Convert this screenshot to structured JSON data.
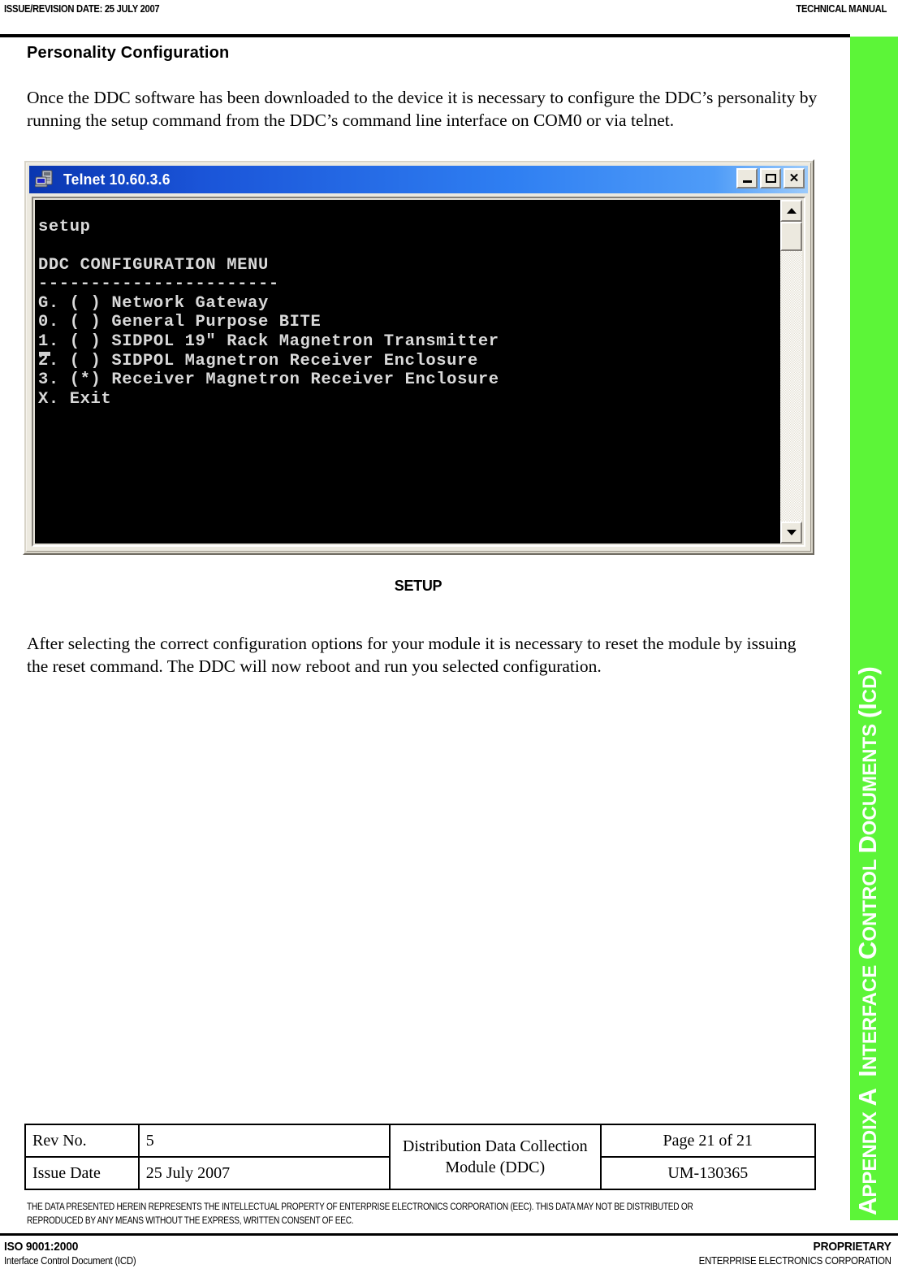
{
  "header": {
    "left": "ISSUE/REVISION DATE:  25 JULY 2007",
    "right": "TECHNICAL MANUAL"
  },
  "appendix_tab": {
    "text": "APPENDIX A  INTERFACE CONTROL DOCUMENTS (ICD)",
    "color": "#5cf538",
    "text_color": "#ffffff"
  },
  "content": {
    "section_title": "Personality Configuration",
    "paragraph_1": "Once the DDC software has been downloaded to the device it is necessary to configure the DDC’s personality by running the setup command from the DDC’s command line interface on COM0 or via telnet.",
    "paragraph_2": "After selecting the correct configuration options for your module it is necessary to reset the module by issuing the reset command. The DDC will now reboot and run you selected configuration.",
    "figure_caption": "SETUP"
  },
  "telnet": {
    "title": "Telnet 10.60.3.6",
    "icon": "telnet-computer-icon",
    "buttons": {
      "minimize": "minimize-button",
      "maximize": "maximize-button",
      "close": "✕"
    },
    "screen_text": "setup\n\nDDC CONFIGURATION MENU\n-----------------------\nG. ( ) Network Gateway\n0. ( ) General Purpose BITE\n1. ( ) SIDPOL 19\" Rack Magnetron Transmitter\n2. ( ) SIDPOL Magnetron Receiver Enclosure\n3. (*) Receiver Magnetron Receiver Enclosure\nX. Exit",
    "menu_lines": [
      "setup",
      "",
      "DDC CONFIGURATION MENU",
      "-----------------------",
      "G. ( ) Network Gateway",
      "0. ( ) General Purpose BITE",
      "1. ( ) SIDPOL 19\" Rack Magnetron Transmitter",
      "2. ( ) SIDPOL Magnetron Receiver Enclosure",
      "3. (*) Receiver Magnetron Receiver Enclosure",
      "X. Exit"
    ],
    "selected_option": "3",
    "scrollbar": {
      "up_arrow": "scroll-up-arrow",
      "down_arrow": "scroll-down-arrow"
    },
    "background": "#000000",
    "text_color": "#d9d9d9"
  },
  "footer_table": {
    "row1": {
      "label": "Rev No.",
      "value": "5",
      "middle": "Distribution Data Collection Module (DDC)",
      "right": "Page 21 of 21"
    },
    "row2": {
      "label": "Issue Date",
      "value": "25 July 2007",
      "right": "UM-130365"
    }
  },
  "proprietary_notice": "THE DATA PRESENTED HEREIN REPRESENTS THE INTELLECTUAL PROPERTY OF ENTERPRISE ELECTRONICS CORPORATION (EEC).  THIS DATA MAY NOT BE DISTRIBUTED OR REPRODUCED BY ANY MEANS WITHOUT THE EXPRESS, WRITTEN CONSENT OF EEC.",
  "page_footer": {
    "left_line1": "ISO 9001:2000",
    "left_line2": "Interface Control Document (ICD)",
    "right_line1": "PROPRIETARY",
    "right_line2": "ENTERPRISE ELECTRONICS CORPORATION"
  }
}
